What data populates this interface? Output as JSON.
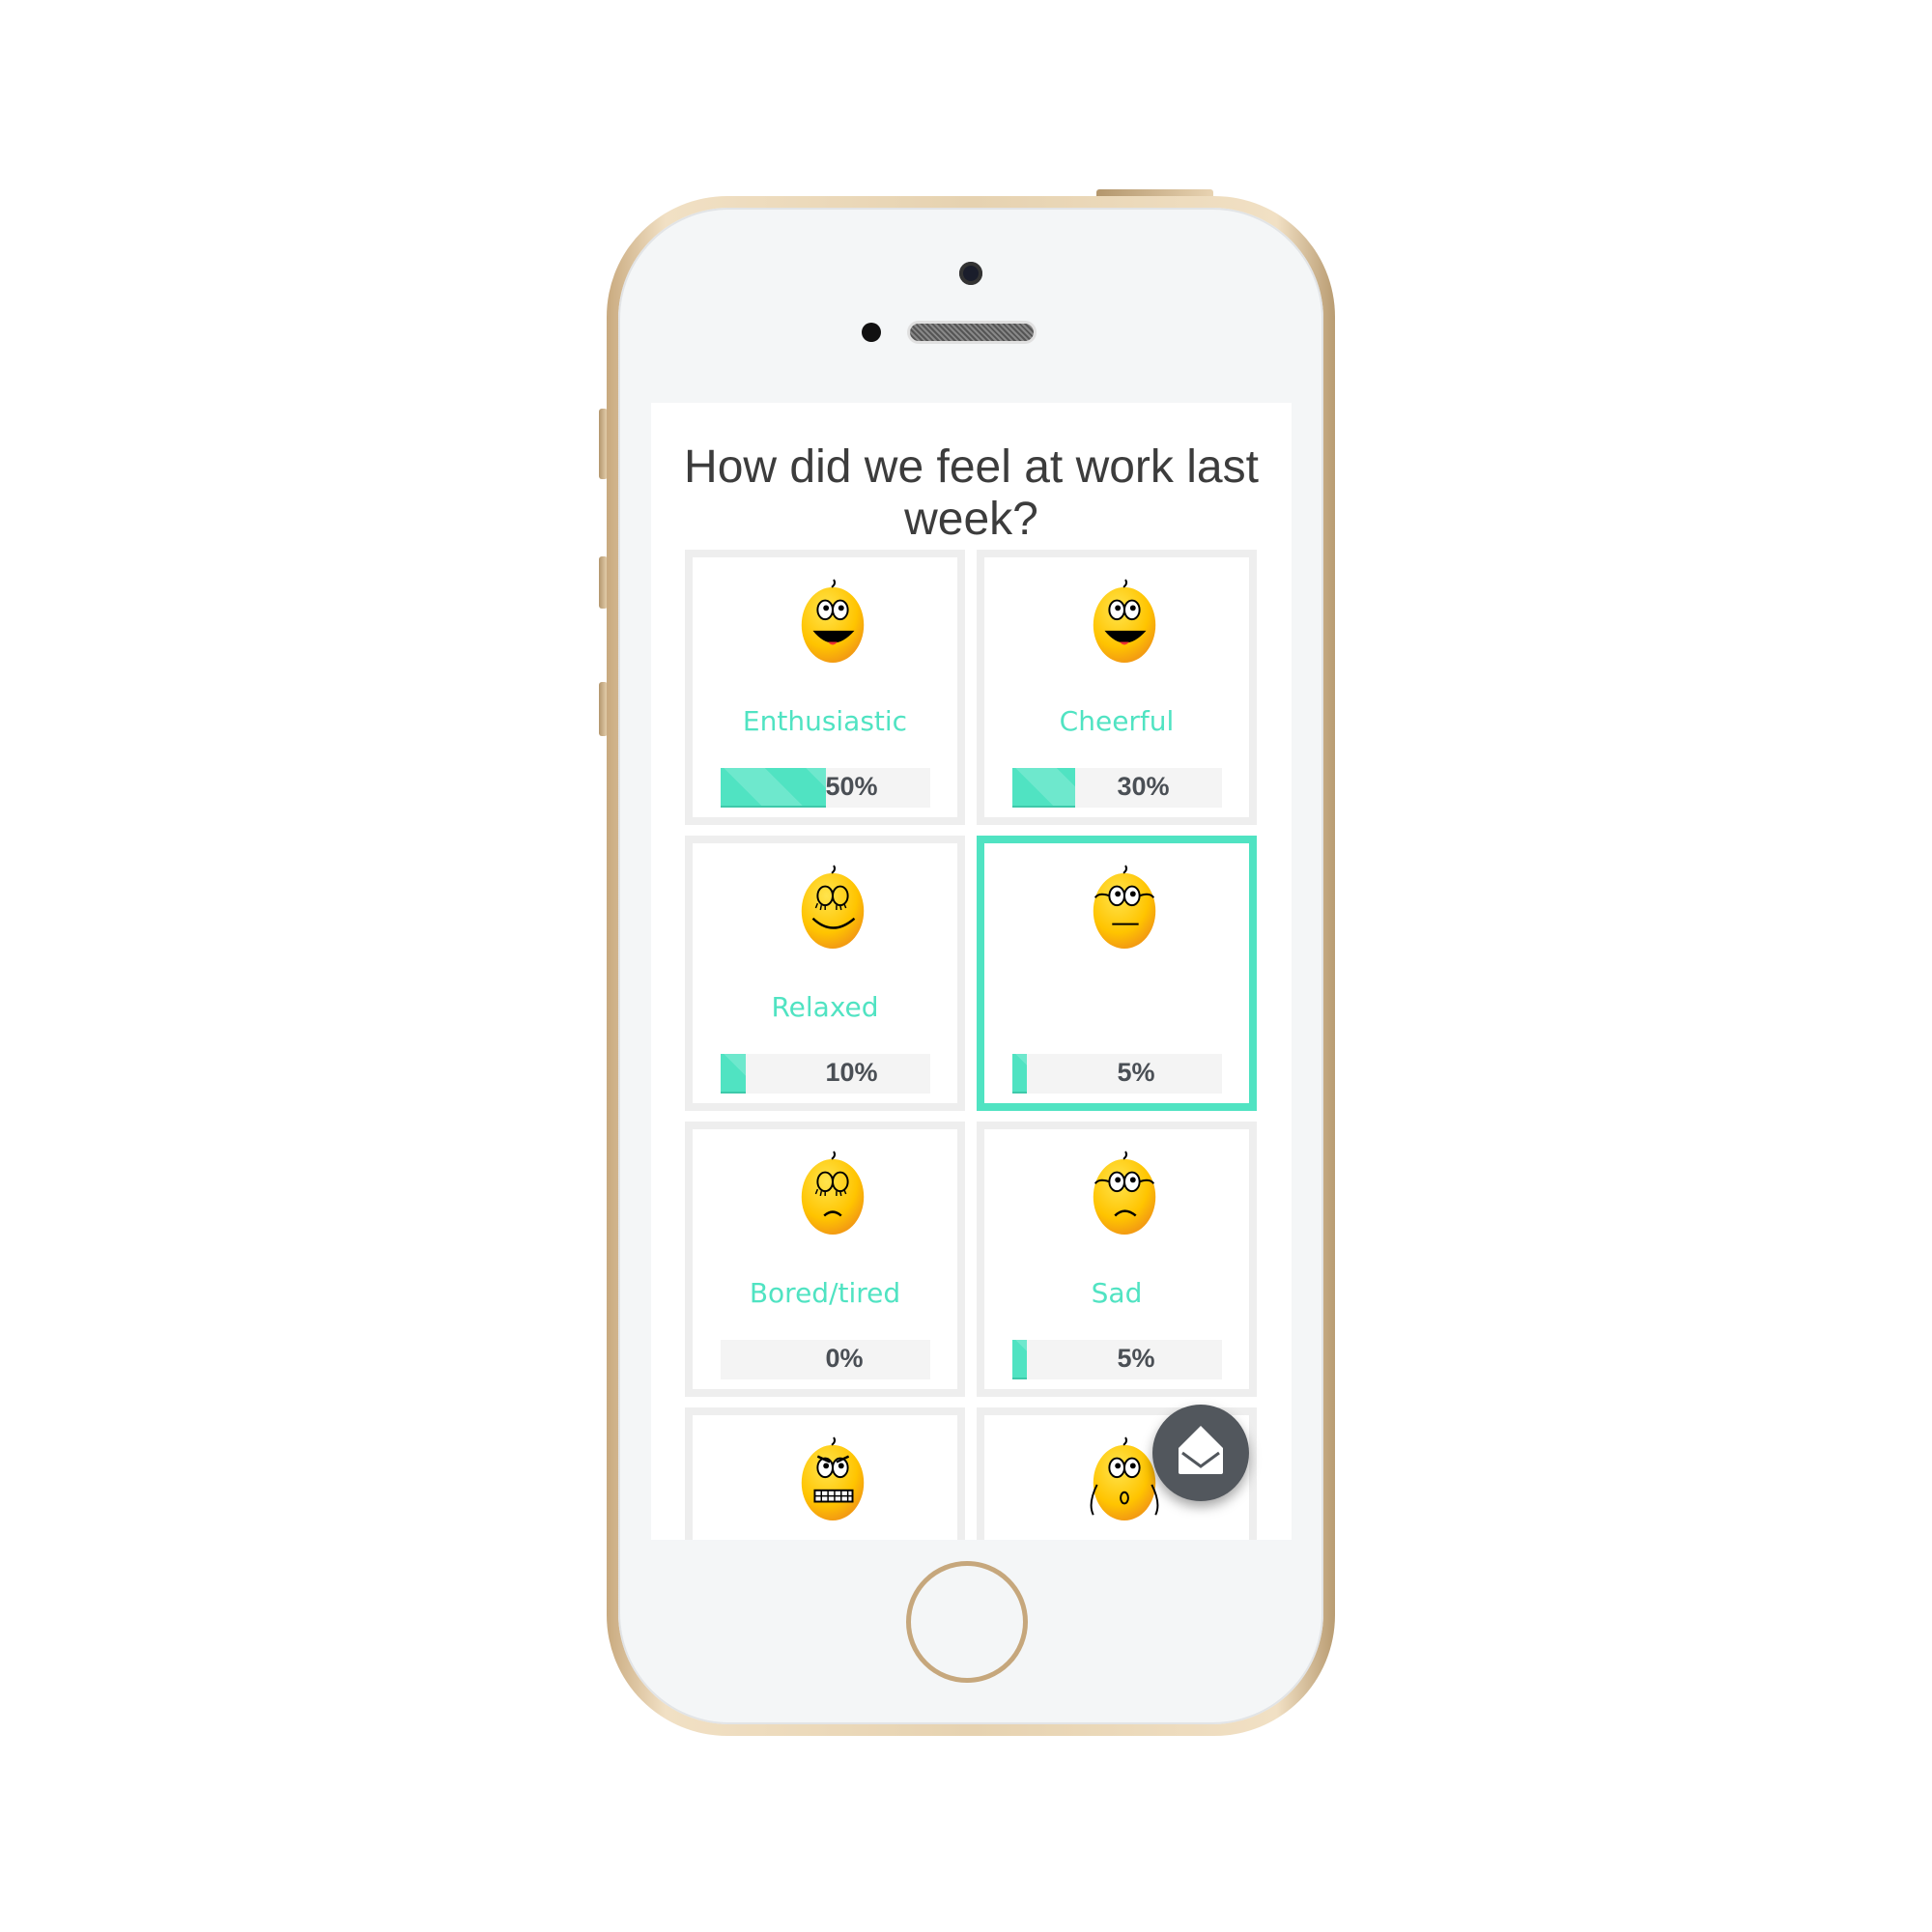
{
  "screen": {
    "title": "How did we feel at work last week?",
    "accent_color": "#50e3c2",
    "fab_icon": "envelope-open-icon",
    "moods": [
      {
        "label": "Enthusiastic",
        "percent_text": "50%",
        "percent": 50,
        "face": "happy",
        "selected": false
      },
      {
        "label": "Cheerful",
        "percent_text": "30%",
        "percent": 30,
        "face": "happy",
        "selected": false
      },
      {
        "label": "Relaxed",
        "percent_text": "10%",
        "percent": 10,
        "face": "relaxed",
        "selected": false
      },
      {
        "label": "",
        "percent_text": "5%",
        "percent": 5,
        "face": "neutral",
        "selected": true
      },
      {
        "label": "Bored/tired",
        "percent_text": "0%",
        "percent": 0,
        "face": "bored",
        "selected": false
      },
      {
        "label": "Sad",
        "percent_text": "5%",
        "percent": 5,
        "face": "sad",
        "selected": false
      },
      {
        "label": "",
        "percent_text": "",
        "percent": null,
        "face": "angry",
        "selected": false
      },
      {
        "label": "",
        "percent_text": "",
        "percent": null,
        "face": "surprised",
        "selected": false
      }
    ]
  }
}
